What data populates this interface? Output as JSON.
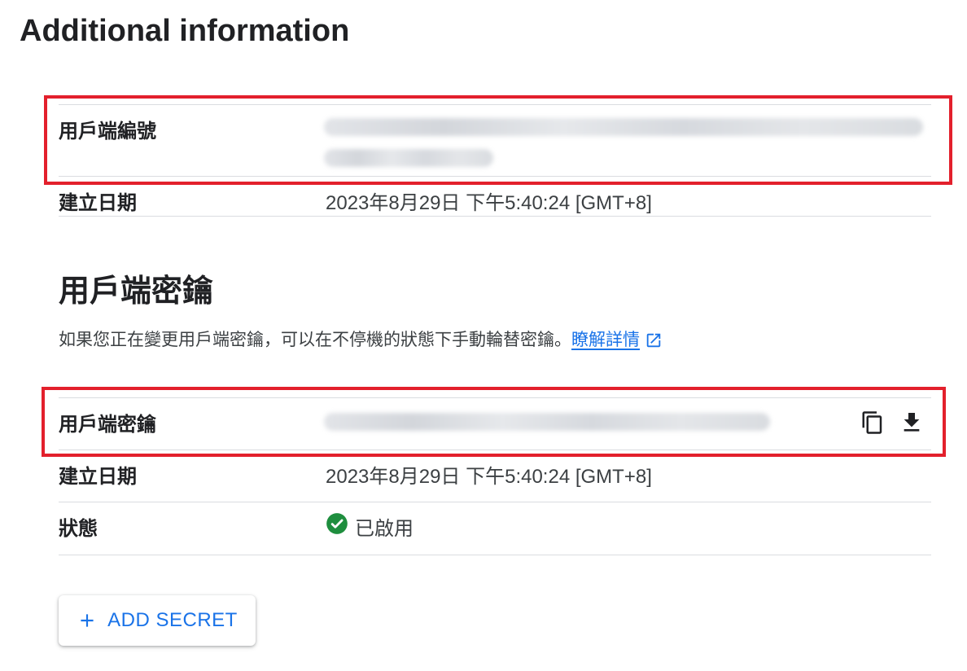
{
  "page_title": "Additional information",
  "client_id": {
    "label": "用戶端編號",
    "value_state": "redacted (blurred)"
  },
  "client_id_created": {
    "label": "建立日期",
    "value": "2023年8月29日 下午5:40:24 [GMT+8]"
  },
  "secrets_section": {
    "title": "用戶端密鑰",
    "description": "如果您正在變更用戶端密鑰，可以在不停機的狀態下手動輪替密鑰。",
    "learn_more": "瞭解詳情"
  },
  "client_secret": {
    "label": "用戶端密鑰",
    "value_state": "redacted (blurred)",
    "icons": [
      "copy-icon",
      "download-icon"
    ]
  },
  "secret_created": {
    "label": "建立日期",
    "value": "2023年8月29日 下午5:40:24 [GMT+8]"
  },
  "secret_status": {
    "label": "狀態",
    "value": "已啟用",
    "icon": "check-circle-icon",
    "color": "#1e8e3e"
  },
  "add_secret_button": {
    "label": "ADD SECRET",
    "icon": "plus-icon"
  },
  "colors": {
    "accent": "#1a73e8",
    "highlight_box": "#e3202c",
    "divider": "#dadce0"
  }
}
